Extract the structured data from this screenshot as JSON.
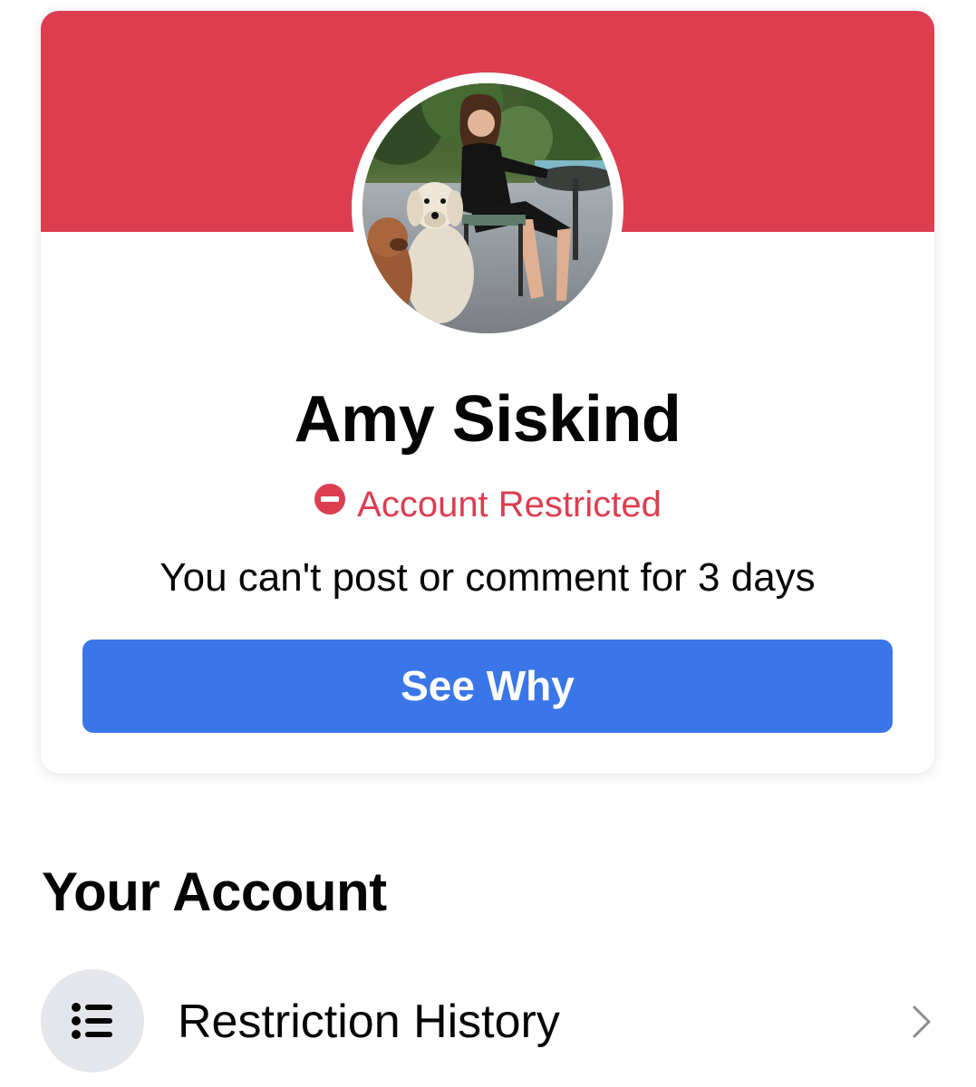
{
  "colors": {
    "banner": "#dc3e50",
    "restricted_text": "#dc3e50",
    "primary_button": "#3b76e8",
    "icon_circle_bg": "#e4e6eb"
  },
  "profile": {
    "name": "Amy Siskind",
    "avatar_icon": "profile-photo"
  },
  "status": {
    "icon": "stop-sign-icon",
    "label": "Account Restricted",
    "description": "You can't post or comment for 3 days"
  },
  "actions": {
    "see_why_label": "See Why"
  },
  "your_account": {
    "title": "Your Account",
    "items": [
      {
        "label": "Restriction History",
        "icon": "list-icon"
      }
    ]
  }
}
